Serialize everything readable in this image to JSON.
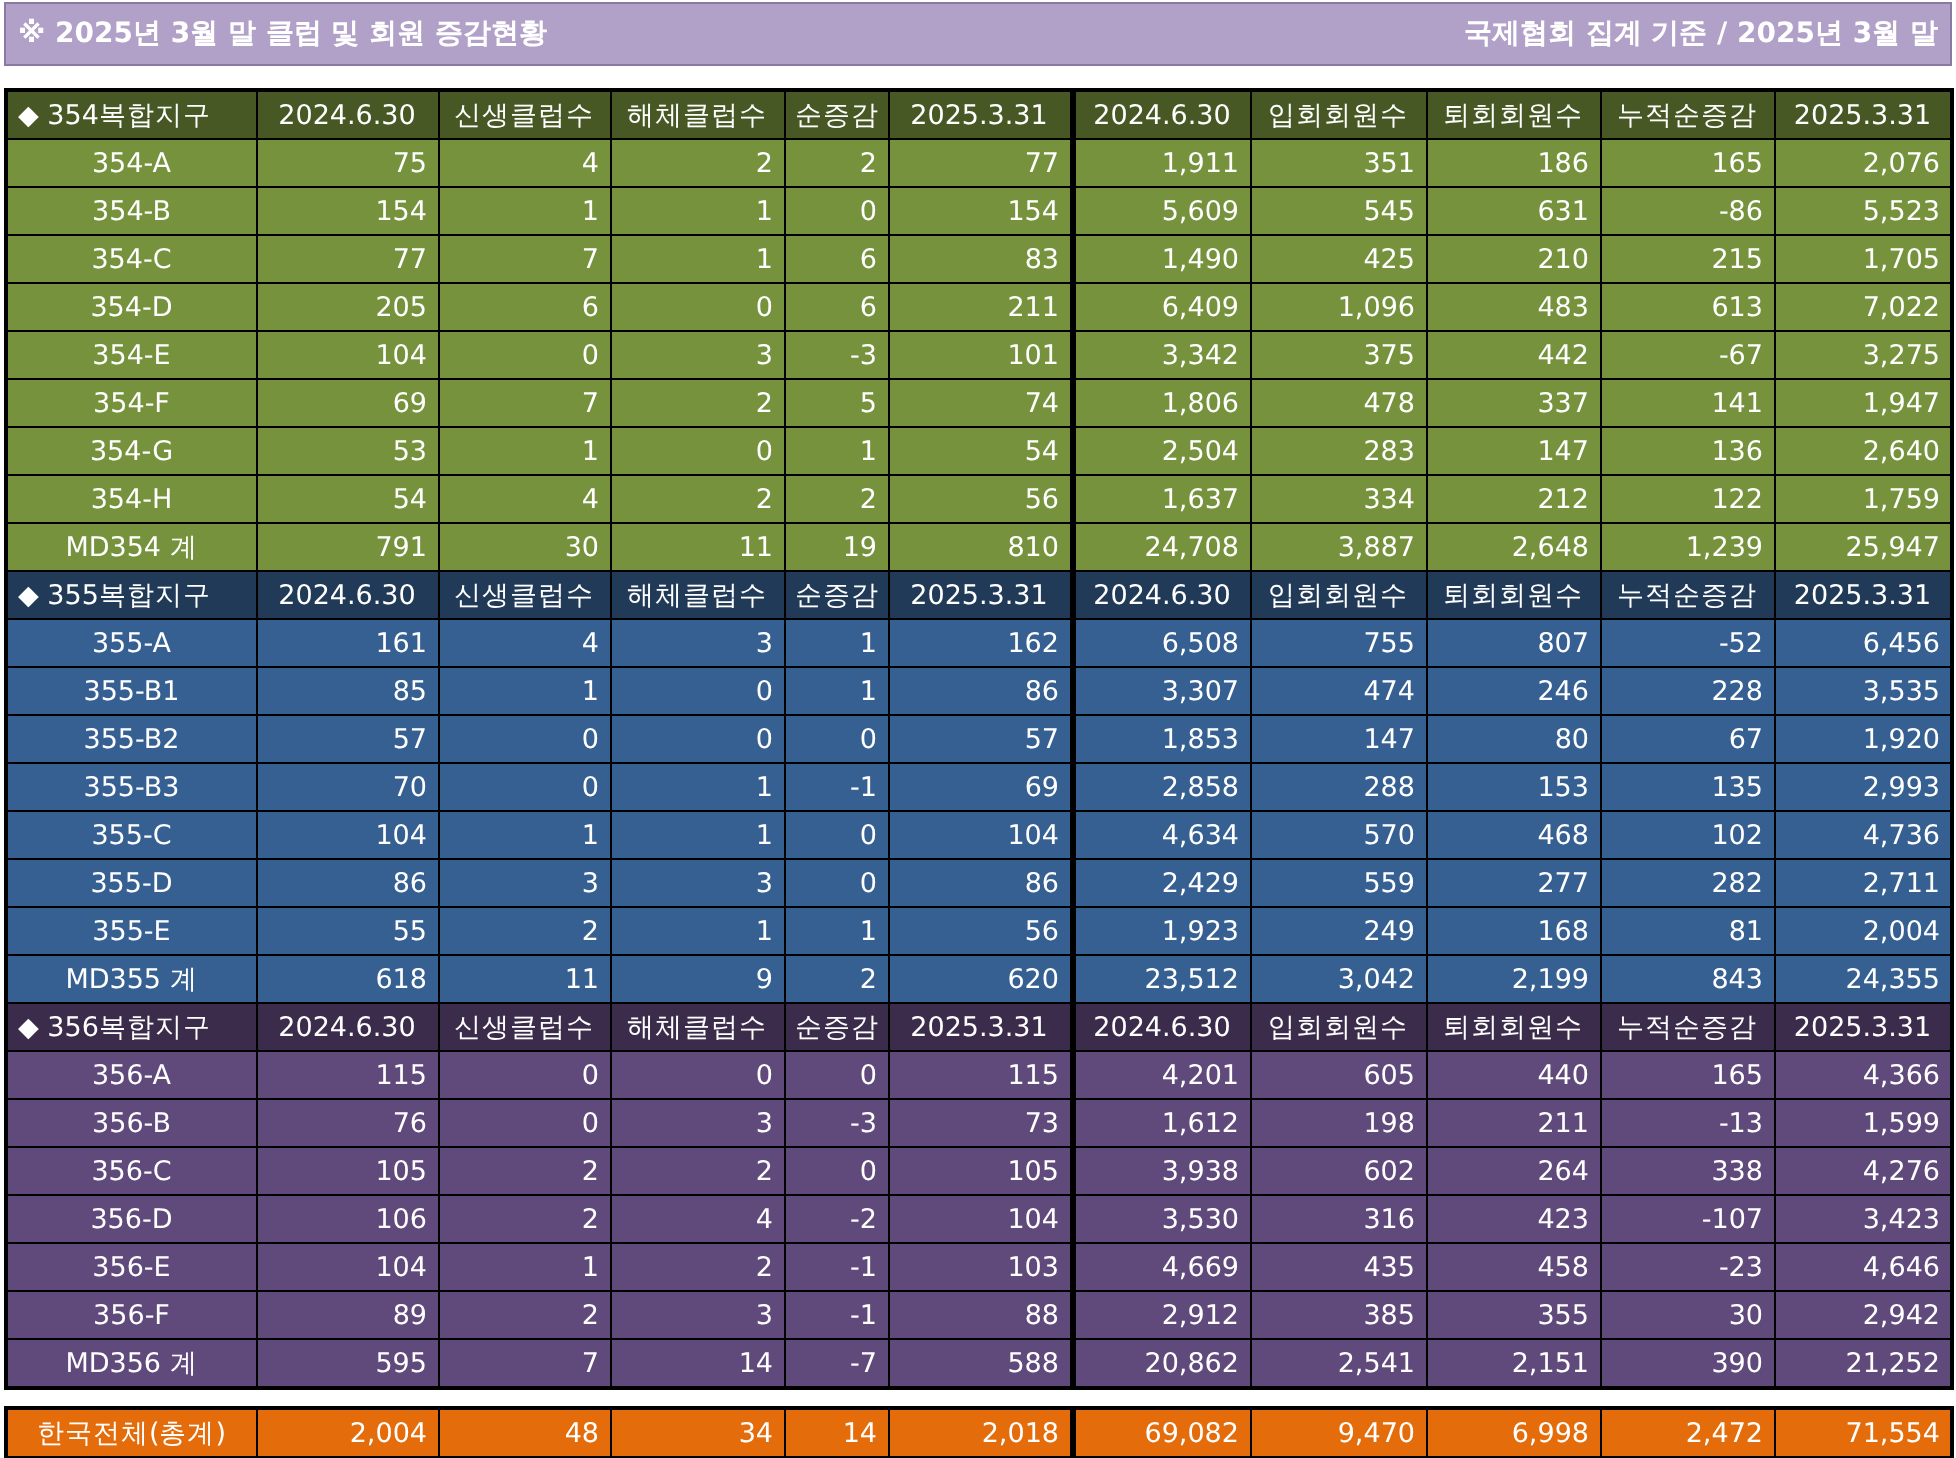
{
  "title": "※ 2025년 3월 말 클럽 및 회원 증감현황",
  "subtitle": "국제협회 집계 기준 / 2025년 3월 말",
  "groups": [
    {
      "color": "#76923c",
      "header": [
        "◆ 354복합지구",
        "2024.6.30",
        "신생클럽수",
        "해체클럽수",
        "순증감",
        "2025.3.31",
        "2024.6.30",
        "입회회원수",
        "퇴회회원수",
        "누적순증감",
        "2025.3.31"
      ],
      "rows": [
        [
          "354-A",
          "75",
          "4",
          "2",
          "2",
          "77",
          "1,911",
          "351",
          "186",
          "165",
          "2,076"
        ],
        [
          "354-B",
          "154",
          "1",
          "1",
          "0",
          "154",
          "5,609",
          "545",
          "631",
          "-86",
          "5,523"
        ],
        [
          "354-C",
          "77",
          "7",
          "1",
          "6",
          "83",
          "1,490",
          "425",
          "210",
          "215",
          "1,705"
        ],
        [
          "354-D",
          "205",
          "6",
          "0",
          "6",
          "211",
          "6,409",
          "1,096",
          "483",
          "613",
          "7,022"
        ],
        [
          "354-E",
          "104",
          "0",
          "3",
          "-3",
          "101",
          "3,342",
          "375",
          "442",
          "-67",
          "3,275"
        ],
        [
          "354-F",
          "69",
          "7",
          "2",
          "5",
          "74",
          "1,806",
          "478",
          "337",
          "141",
          "1,947"
        ],
        [
          "354-G",
          "53",
          "1",
          "0",
          "1",
          "54",
          "2,504",
          "283",
          "147",
          "136",
          "2,640"
        ],
        [
          "354-H",
          "54",
          "4",
          "2",
          "2",
          "56",
          "1,637",
          "334",
          "212",
          "122",
          "1,759"
        ]
      ],
      "total": [
        "MD354 계",
        "791",
        "30",
        "11",
        "19",
        "810",
        "24,708",
        "3,887",
        "2,648",
        "1,239",
        "25,947"
      ]
    },
    {
      "color": "#366092",
      "header": [
        "◆ 355복합지구",
        "2024.6.30",
        "신생클럽수",
        "해체클럽수",
        "순증감",
        "2025.3.31",
        "2024.6.30",
        "입회회원수",
        "퇴회회원수",
        "누적순증감",
        "2025.3.31"
      ],
      "rows": [
        [
          "355-A",
          "161",
          "4",
          "3",
          "1",
          "162",
          "6,508",
          "755",
          "807",
          "-52",
          "6,456"
        ],
        [
          "355-B1",
          "85",
          "1",
          "0",
          "1",
          "86",
          "3,307",
          "474",
          "246",
          "228",
          "3,535"
        ],
        [
          "355-B2",
          "57",
          "0",
          "0",
          "0",
          "57",
          "1,853",
          "147",
          "80",
          "67",
          "1,920"
        ],
        [
          "355-B3",
          "70",
          "0",
          "1",
          "-1",
          "69",
          "2,858",
          "288",
          "153",
          "135",
          "2,993"
        ],
        [
          "355-C",
          "104",
          "1",
          "1",
          "0",
          "104",
          "4,634",
          "570",
          "468",
          "102",
          "4,736"
        ],
        [
          "355-D",
          "86",
          "3",
          "3",
          "0",
          "86",
          "2,429",
          "559",
          "277",
          "282",
          "2,711"
        ],
        [
          "355-E",
          "55",
          "2",
          "1",
          "1",
          "56",
          "1,923",
          "249",
          "168",
          "81",
          "2,004"
        ]
      ],
      "total": [
        "MD355 계",
        "618",
        "11",
        "9",
        "2",
        "620",
        "23,512",
        "3,042",
        "2,199",
        "843",
        "24,355"
      ]
    },
    {
      "color": "#604a7b",
      "header": [
        "◆ 356복합지구",
        "2024.6.30",
        "신생클럽수",
        "해체클럽수",
        "순증감",
        "2025.3.31",
        "2024.6.30",
        "입회회원수",
        "퇴회회원수",
        "누적순증감",
        "2025.3.31"
      ],
      "rows": [
        [
          "356-A",
          "115",
          "0",
          "0",
          "0",
          "115",
          "4,201",
          "605",
          "440",
          "165",
          "4,366"
        ],
        [
          "356-B",
          "76",
          "0",
          "3",
          "-3",
          "73",
          "1,612",
          "198",
          "211",
          "-13",
          "1,599"
        ],
        [
          "356-C",
          "105",
          "2",
          "2",
          "0",
          "105",
          "3,938",
          "602",
          "264",
          "338",
          "4,276"
        ],
        [
          "356-D",
          "106",
          "2",
          "4",
          "-2",
          "104",
          "3,530",
          "316",
          "423",
          "-107",
          "3,423"
        ],
        [
          "356-E",
          "104",
          "1",
          "2",
          "-1",
          "103",
          "4,669",
          "435",
          "458",
          "-23",
          "4,646"
        ],
        [
          "356-F",
          "89",
          "2",
          "3",
          "-1",
          "88",
          "2,912",
          "385",
          "355",
          "30",
          "2,942"
        ]
      ],
      "total": [
        "MD356 계",
        "595",
        "7",
        "14",
        "-7",
        "588",
        "20,862",
        "2,541",
        "2,151",
        "390",
        "21,252"
      ]
    }
  ],
  "grand_total": {
    "color": "#e46c0a",
    "cells": [
      "한국전체(총계)",
      "2,004",
      "48",
      "34",
      "14",
      "2,018",
      "69,082",
      "9,470",
      "6,998",
      "2,472",
      "71,554"
    ]
  }
}
